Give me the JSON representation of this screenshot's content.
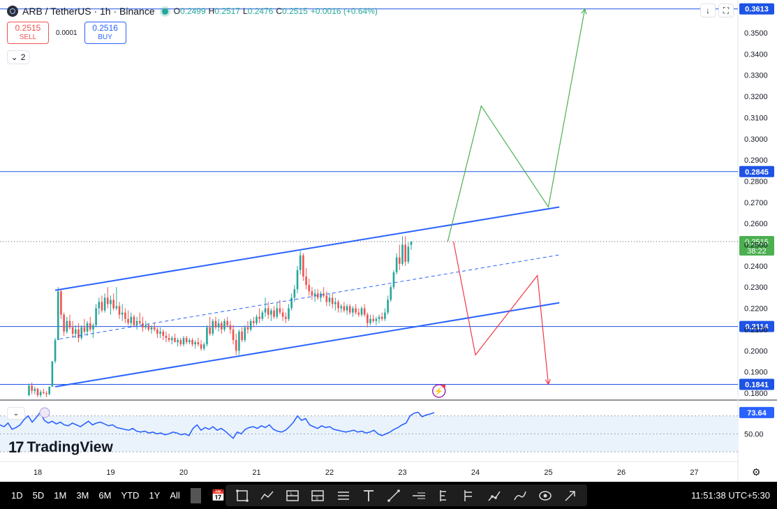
{
  "header": {
    "symbol": "ARB / TetherUS · 1h · Binance",
    "ohlc": [
      {
        "k": "O",
        "v": "0.2499"
      },
      {
        "k": "H",
        "v": "0.2517"
      },
      {
        "k": "L",
        "v": "0.2476"
      },
      {
        "k": "C",
        "v": "0.2515"
      },
      {
        "k": "",
        "v": "+0.0016 (+0.64%)"
      }
    ]
  },
  "trade": {
    "sell_price": "0.2515",
    "sell_label": "SELL",
    "spread": "0.0001",
    "buy_price": "0.2516",
    "buy_label": "BUY"
  },
  "indicator_toggle": {
    "count": "2"
  },
  "watermark": "TradingView",
  "colors": {
    "up": "#26a69a",
    "down": "#ef5350",
    "channel": "#2962ff",
    "level": "#1e53e5",
    "green_path": "#4caf50",
    "red_path": "#f23645",
    "rsi": "#2962ff",
    "rsi_band": "#eaf3fc",
    "price_tag": "#4caf50"
  },
  "chart_data": {
    "type": "candlestick",
    "symbol": "ARB / TetherUS",
    "interval": "1h",
    "ylim": [
      0.175,
      0.365
    ],
    "y_ticks": [
      "0.3500",
      "0.3400",
      "0.3300",
      "0.3200",
      "0.3100",
      "0.3000",
      "0.2900",
      "0.2800",
      "0.2700",
      "0.2600",
      "0.2500",
      "0.2400",
      "0.2300",
      "0.2200",
      "0.2100",
      "0.2000",
      "0.1900",
      "0.1800"
    ],
    "x_ticks": [
      "18",
      "19",
      "20",
      "21",
      "22",
      "23",
      "24",
      "25",
      "26",
      "27"
    ],
    "horizontal_levels": [
      {
        "label": "0.3613",
        "value": 0.3613
      },
      {
        "label": "0.2845",
        "value": 0.2845
      },
      {
        "label": "0.2114",
        "value": 0.2114
      },
      {
        "label": "0.1841",
        "value": 0.1841
      }
    ],
    "last_price": {
      "label": "0.2515",
      "value": 0.2515,
      "countdown": "38:22"
    },
    "channel": {
      "upper": [
        [
          18.24,
          0.2285
        ],
        [
          25.15,
          0.2678
        ]
      ],
      "lower": [
        [
          18.24,
          0.183
        ],
        [
          25.15,
          0.2226
        ]
      ],
      "middle": [
        [
          18.3,
          0.2055
        ],
        [
          25.15,
          0.2452
        ]
      ]
    },
    "green_projection": [
      [
        23.62,
        0.2515
      ],
      [
        24.08,
        0.3155
      ],
      [
        25.0,
        0.2678
      ],
      [
        25.5,
        0.3613
      ]
    ],
    "red_projection": [
      [
        23.7,
        0.2515
      ],
      [
        24.0,
        0.198
      ],
      [
        24.85,
        0.2355
      ],
      [
        25.0,
        0.1841
      ]
    ],
    "candles": [
      [
        17.88,
        0.179,
        0.1845,
        0.1785,
        0.1835
      ],
      [
        17.92,
        0.1835,
        0.185,
        0.1795,
        0.181
      ],
      [
        17.96,
        0.181,
        0.183,
        0.1795,
        0.182
      ],
      [
        18.0,
        0.182,
        0.1825,
        0.178,
        0.179
      ],
      [
        18.04,
        0.179,
        0.1815,
        0.178,
        0.1805
      ],
      [
        18.08,
        0.1805,
        0.182,
        0.1795,
        0.18
      ],
      [
        18.12,
        0.18,
        0.181,
        0.178,
        0.1795
      ],
      [
        18.16,
        0.1795,
        0.183,
        0.179,
        0.183
      ],
      [
        18.2,
        0.183,
        0.195,
        0.183,
        0.195
      ],
      [
        18.24,
        0.195,
        0.206,
        0.194,
        0.205
      ],
      [
        18.28,
        0.205,
        0.23,
        0.205,
        0.228
      ],
      [
        18.32,
        0.228,
        0.229,
        0.215,
        0.217
      ],
      [
        18.36,
        0.217,
        0.218,
        0.207,
        0.209
      ],
      [
        18.4,
        0.209,
        0.216,
        0.208,
        0.214
      ],
      [
        18.44,
        0.214,
        0.217,
        0.21,
        0.211
      ],
      [
        18.48,
        0.211,
        0.214,
        0.206,
        0.208
      ],
      [
        18.52,
        0.208,
        0.212,
        0.206,
        0.21
      ],
      [
        18.56,
        0.21,
        0.213,
        0.204,
        0.206
      ],
      [
        18.6,
        0.206,
        0.212,
        0.205,
        0.211
      ],
      [
        18.64,
        0.211,
        0.215,
        0.208,
        0.209
      ],
      [
        18.68,
        0.209,
        0.214,
        0.207,
        0.213
      ],
      [
        18.72,
        0.213,
        0.216,
        0.209,
        0.21
      ],
      [
        18.76,
        0.21,
        0.213,
        0.206,
        0.212
      ],
      [
        18.8,
        0.212,
        0.222,
        0.211,
        0.22
      ],
      [
        18.84,
        0.22,
        0.225,
        0.217,
        0.223
      ],
      [
        18.88,
        0.223,
        0.226,
        0.218,
        0.219
      ],
      [
        18.92,
        0.219,
        0.227,
        0.218,
        0.225
      ],
      [
        18.96,
        0.225,
        0.23,
        0.22,
        0.222
      ],
      [
        19.0,
        0.222,
        0.226,
        0.217,
        0.224
      ],
      [
        19.04,
        0.224,
        0.227,
        0.219,
        0.22
      ],
      [
        19.08,
        0.22,
        0.23,
        0.219,
        0.221
      ],
      [
        19.12,
        0.221,
        0.223,
        0.215,
        0.217
      ],
      [
        19.16,
        0.217,
        0.222,
        0.214,
        0.218
      ],
      [
        19.2,
        0.218,
        0.22,
        0.213,
        0.215
      ],
      [
        19.24,
        0.215,
        0.219,
        0.212,
        0.213
      ],
      [
        19.28,
        0.213,
        0.218,
        0.211,
        0.216
      ],
      [
        19.32,
        0.216,
        0.217,
        0.211,
        0.212
      ],
      [
        19.36,
        0.212,
        0.216,
        0.21,
        0.214
      ],
      [
        19.4,
        0.214,
        0.218,
        0.212,
        0.213
      ],
      [
        19.44,
        0.213,
        0.216,
        0.209,
        0.211
      ],
      [
        19.48,
        0.211,
        0.214,
        0.21,
        0.212
      ],
      [
        19.52,
        0.212,
        0.213,
        0.209,
        0.21
      ],
      [
        19.56,
        0.21,
        0.212,
        0.208,
        0.211
      ],
      [
        19.6,
        0.211,
        0.213,
        0.209,
        0.21
      ],
      [
        19.64,
        0.21,
        0.211,
        0.206,
        0.208
      ],
      [
        19.68,
        0.208,
        0.211,
        0.206,
        0.209
      ],
      [
        19.72,
        0.209,
        0.21,
        0.205,
        0.207
      ],
      [
        19.76,
        0.207,
        0.209,
        0.204,
        0.206
      ],
      [
        19.8,
        0.206,
        0.208,
        0.204,
        0.205
      ],
      [
        19.84,
        0.205,
        0.207,
        0.203,
        0.206
      ],
      [
        19.88,
        0.206,
        0.208,
        0.204,
        0.204
      ],
      [
        19.92,
        0.204,
        0.206,
        0.202,
        0.205
      ],
      [
        19.96,
        0.205,
        0.206,
        0.202,
        0.203
      ],
      [
        20.0,
        0.203,
        0.207,
        0.202,
        0.206
      ],
      [
        20.04,
        0.206,
        0.207,
        0.203,
        0.204
      ],
      [
        20.08,
        0.204,
        0.206,
        0.203,
        0.205
      ],
      [
        20.12,
        0.205,
        0.206,
        0.202,
        0.203
      ],
      [
        20.16,
        0.203,
        0.205,
        0.201,
        0.204
      ],
      [
        20.2,
        0.204,
        0.206,
        0.202,
        0.203
      ],
      [
        20.24,
        0.203,
        0.205,
        0.2,
        0.201
      ],
      [
        20.28,
        0.201,
        0.204,
        0.2,
        0.203
      ],
      [
        20.32,
        0.203,
        0.212,
        0.202,
        0.211
      ],
      [
        20.36,
        0.211,
        0.216,
        0.207,
        0.208
      ],
      [
        20.4,
        0.208,
        0.215,
        0.207,
        0.214
      ],
      [
        20.44,
        0.214,
        0.216,
        0.21,
        0.211
      ],
      [
        20.48,
        0.211,
        0.215,
        0.209,
        0.213
      ],
      [
        20.52,
        0.213,
        0.214,
        0.208,
        0.21
      ],
      [
        20.56,
        0.21,
        0.215,
        0.209,
        0.214
      ],
      [
        20.6,
        0.214,
        0.216,
        0.211,
        0.212
      ],
      [
        20.64,
        0.212,
        0.214,
        0.208,
        0.21
      ],
      [
        20.68,
        0.21,
        0.212,
        0.203,
        0.205
      ],
      [
        20.72,
        0.205,
        0.208,
        0.198,
        0.2
      ],
      [
        20.76,
        0.2,
        0.21,
        0.198,
        0.209
      ],
      [
        20.8,
        0.209,
        0.211,
        0.204,
        0.205
      ],
      [
        20.84,
        0.205,
        0.212,
        0.204,
        0.211
      ],
      [
        20.88,
        0.211,
        0.214,
        0.208,
        0.21
      ],
      [
        20.92,
        0.21,
        0.215,
        0.209,
        0.214
      ],
      [
        20.96,
        0.214,
        0.216,
        0.211,
        0.213
      ],
      [
        21.0,
        0.213,
        0.217,
        0.212,
        0.216
      ],
      [
        21.04,
        0.216,
        0.22,
        0.213,
        0.215
      ],
      [
        21.08,
        0.215,
        0.219,
        0.214,
        0.218
      ],
      [
        21.12,
        0.218,
        0.225,
        0.216,
        0.22
      ],
      [
        21.16,
        0.22,
        0.223,
        0.215,
        0.217
      ],
      [
        21.2,
        0.217,
        0.22,
        0.214,
        0.219
      ],
      [
        21.24,
        0.219,
        0.221,
        0.215,
        0.216
      ],
      [
        21.28,
        0.216,
        0.223,
        0.215,
        0.22
      ],
      [
        21.32,
        0.22,
        0.224,
        0.217,
        0.218
      ],
      [
        21.36,
        0.218,
        0.22,
        0.214,
        0.216
      ],
      [
        21.4,
        0.216,
        0.218,
        0.213,
        0.215
      ],
      [
        21.44,
        0.215,
        0.222,
        0.214,
        0.22
      ],
      [
        21.48,
        0.22,
        0.227,
        0.219,
        0.225
      ],
      [
        21.52,
        0.225,
        0.231,
        0.223,
        0.229
      ],
      [
        21.56,
        0.229,
        0.24,
        0.227,
        0.238
      ],
      [
        21.6,
        0.238,
        0.247,
        0.236,
        0.245
      ],
      [
        21.64,
        0.245,
        0.246,
        0.233,
        0.235
      ],
      [
        21.68,
        0.235,
        0.239,
        0.229,
        0.231
      ],
      [
        21.72,
        0.231,
        0.234,
        0.226,
        0.228
      ],
      [
        21.76,
        0.228,
        0.23,
        0.224,
        0.226
      ],
      [
        21.8,
        0.226,
        0.229,
        0.223,
        0.227
      ],
      [
        21.84,
        0.227,
        0.229,
        0.224,
        0.225
      ],
      [
        21.88,
        0.225,
        0.228,
        0.223,
        0.227
      ],
      [
        21.92,
        0.227,
        0.23,
        0.225,
        0.226
      ],
      [
        21.96,
        0.226,
        0.228,
        0.221,
        0.223
      ],
      [
        22.0,
        0.223,
        0.227,
        0.221,
        0.225
      ],
      [
        22.04,
        0.225,
        0.227,
        0.22,
        0.222
      ],
      [
        22.08,
        0.222,
        0.225,
        0.219,
        0.223
      ],
      [
        22.12,
        0.223,
        0.224,
        0.218,
        0.22
      ],
      [
        22.16,
        0.22,
        0.222,
        0.218,
        0.221
      ],
      [
        22.2,
        0.221,
        0.223,
        0.218,
        0.219
      ],
      [
        22.24,
        0.219,
        0.222,
        0.217,
        0.221
      ],
      [
        22.28,
        0.221,
        0.222,
        0.217,
        0.218
      ],
      [
        22.32,
        0.218,
        0.221,
        0.216,
        0.22
      ],
      [
        22.36,
        0.22,
        0.222,
        0.217,
        0.218
      ],
      [
        22.4,
        0.218,
        0.22,
        0.216,
        0.217
      ],
      [
        22.44,
        0.217,
        0.221,
        0.216,
        0.22
      ],
      [
        22.48,
        0.22,
        0.222,
        0.216,
        0.217
      ],
      [
        22.52,
        0.217,
        0.218,
        0.211,
        0.213
      ],
      [
        22.56,
        0.213,
        0.217,
        0.212,
        0.215
      ],
      [
        22.6,
        0.215,
        0.217,
        0.213,
        0.214
      ],
      [
        22.64,
        0.214,
        0.216,
        0.212,
        0.215
      ],
      [
        22.68,
        0.215,
        0.217,
        0.213,
        0.216
      ],
      [
        22.72,
        0.216,
        0.218,
        0.214,
        0.215
      ],
      [
        22.76,
        0.215,
        0.22,
        0.214,
        0.218
      ],
      [
        22.8,
        0.218,
        0.226,
        0.217,
        0.224
      ],
      [
        22.84,
        0.224,
        0.231,
        0.223,
        0.23
      ],
      [
        22.88,
        0.23,
        0.238,
        0.229,
        0.237
      ],
      [
        22.92,
        0.237,
        0.246,
        0.236,
        0.244
      ],
      [
        22.96,
        0.244,
        0.25,
        0.238,
        0.241
      ],
      [
        23.0,
        0.241,
        0.254,
        0.24,
        0.25
      ],
      [
        23.04,
        0.25,
        0.254,
        0.24,
        0.242
      ],
      [
        23.08,
        0.242,
        0.251,
        0.241,
        0.249
      ],
      [
        23.12,
        0.2499,
        0.2517,
        0.2476,
        0.2515
      ]
    ]
  },
  "rsi": {
    "value_label": "73.64",
    "level_label": "50.00",
    "upper": 70,
    "lower": 30,
    "ylim": [
      20,
      86
    ],
    "values": [
      60,
      58,
      62,
      55,
      57,
      60,
      66,
      70,
      63,
      68,
      74,
      65,
      62,
      64,
      61,
      63,
      60,
      59,
      62,
      60,
      58,
      61,
      64,
      60,
      62,
      63,
      61,
      59,
      60,
      57,
      56,
      55,
      54,
      56,
      53,
      52,
      53,
      51,
      52,
      50,
      51,
      49,
      50,
      52,
      51,
      49,
      50,
      48,
      56,
      60,
      54,
      57,
      55,
      58,
      54,
      56,
      53,
      49,
      45,
      52,
      50,
      55,
      57,
      58,
      56,
      59,
      57,
      60,
      55,
      53,
      52,
      54,
      58,
      63,
      70,
      65,
      67,
      60,
      58,
      56,
      59,
      57,
      58,
      55,
      54,
      53,
      52,
      53,
      54,
      52,
      53,
      51,
      52,
      54,
      50,
      48,
      50,
      52,
      55,
      57,
      60,
      62,
      70,
      73,
      74,
      69,
      71,
      72,
      73.64
    ]
  },
  "bottom_bar": {
    "ranges": [
      "1D",
      "5D",
      "1M",
      "3M",
      "6M",
      "YTD",
      "1Y",
      "All"
    ],
    "clock": "11:51:38 UTC+5:30",
    "tools": [
      "rectangle-tool-icon",
      "zigzag-pattern-tool-icon",
      "long-position-tool-icon",
      "short-position-tool-icon",
      "parallel-channel-tool-icon",
      "text-tool-icon",
      "trend-line-tool-icon",
      "horizontal-ray-tool-icon",
      "fib-retracement-tool-icon",
      "pitchfork-tool-icon",
      "path-tool-icon",
      "brush-tool-icon",
      "eye-icon",
      "arrow-tool-icon"
    ]
  }
}
